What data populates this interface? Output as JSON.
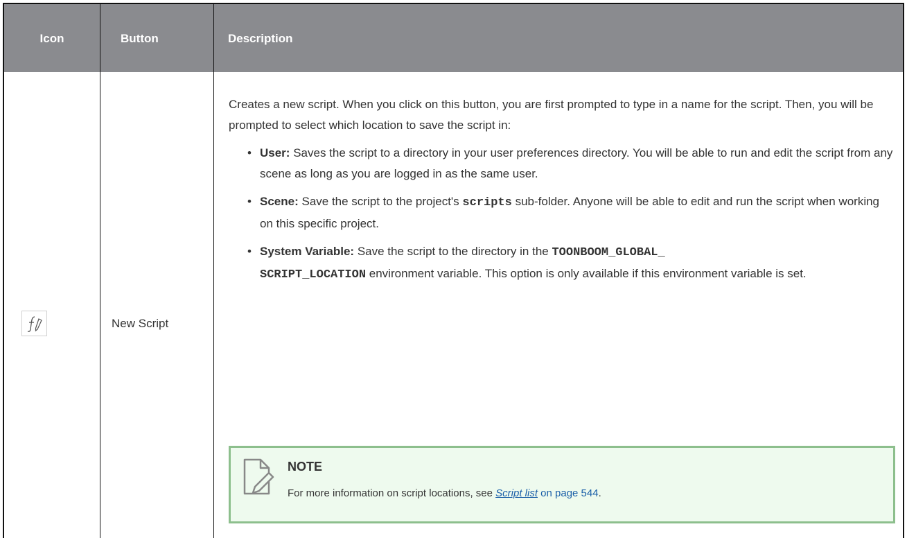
{
  "table": {
    "headers": {
      "icon": "Icon",
      "button": "Button",
      "description": "Description"
    },
    "row": {
      "icon": "new-script-icon",
      "button": "New Script",
      "intro": "Creates a new script. When you click on this button, you are first prompted to type in a name for the script. Then, you will be prompted to select which location to save the script in:",
      "bullets": [
        {
          "label": "User:",
          "text": "Saves the script to a directory in your user preferences directory. You will be able to run and edit the script from any scene as long as you are logged in as the same user."
        },
        {
          "label": "Scene:",
          "before": "Save the script to the project's",
          "code": "scripts",
          "after": "sub-folder. Anyone will be able to edit and run the script when working on this specific project."
        },
        {
          "label": "System Variable:",
          "before": "Save the script to the directory in the",
          "code1": "TOONBOOM_GLOBAL_",
          "code2": "SCRIPT_LOCATION",
          "after": "environment variable. This option is only available if this environment variable is set."
        }
      ]
    }
  },
  "note": {
    "title": "NOTE",
    "text_before": "For more information on script locations, see",
    "link": "Script list",
    "page_ref": "on page 544",
    "text_after": "."
  },
  "colors": {
    "header_bg": "#8a8b8f",
    "note_bg": "#eefaee",
    "note_border": "#8dbf8d",
    "link": "#1a5fa8"
  }
}
